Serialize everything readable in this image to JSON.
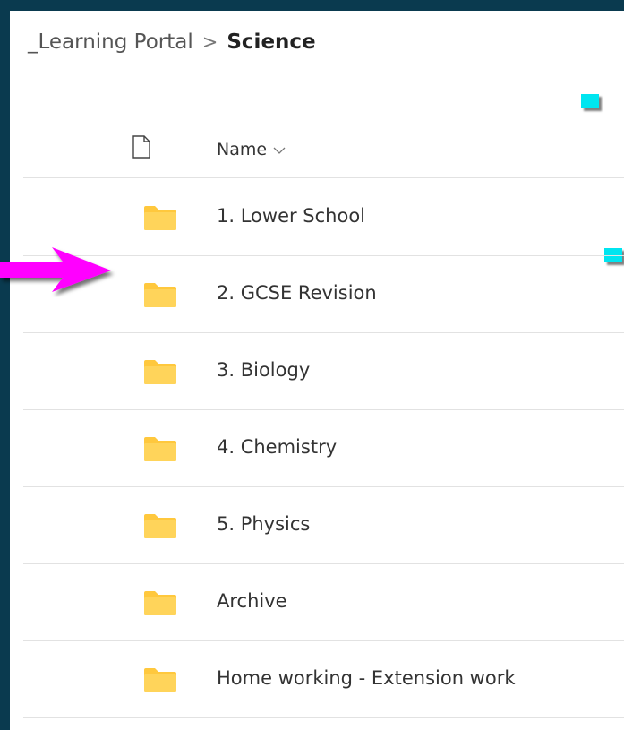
{
  "breadcrumb": {
    "parent": "_Learning Portal",
    "separator": ">",
    "current": "Science"
  },
  "list": {
    "name_header": "Name",
    "items": [
      {
        "name": "1. Lower School"
      },
      {
        "name": "2. GCSE Revision"
      },
      {
        "name": "3. Biology"
      },
      {
        "name": "4. Chemistry"
      },
      {
        "name": "5. Physics"
      },
      {
        "name": "Archive"
      },
      {
        "name": "Home working - Extension work"
      }
    ]
  },
  "colors": {
    "background": "#0a3a4f",
    "folder": "#ffc83d",
    "marker": "#00e5f0",
    "arrow": "#ff00ff"
  },
  "icons": [
    "file-icon",
    "folder-icon",
    "chevron-down-icon",
    "arrow-pointer"
  ]
}
